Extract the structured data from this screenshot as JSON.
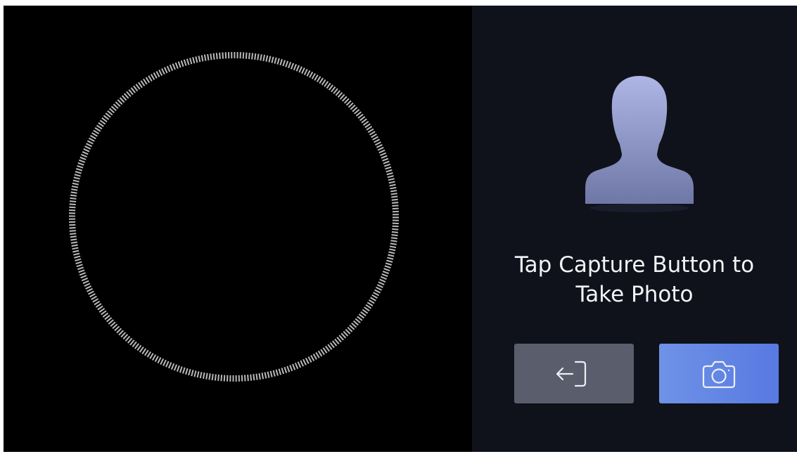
{
  "camera_view": {
    "face_guide_icon": "dashed-circle"
  },
  "side_panel": {
    "avatar_icon": "user-silhouette-icon",
    "prompt_line1": "Tap Capture Button to",
    "prompt_line2": "Take Photo",
    "buttons": {
      "exit_icon": "exit-arrow-icon",
      "capture_icon": "camera-icon"
    }
  },
  "colors": {
    "background": "#000000",
    "panel": "#0f121a",
    "exit_button": "#5a5d6c",
    "capture_button": "#5f82e4",
    "text": "#f2f3f7"
  }
}
